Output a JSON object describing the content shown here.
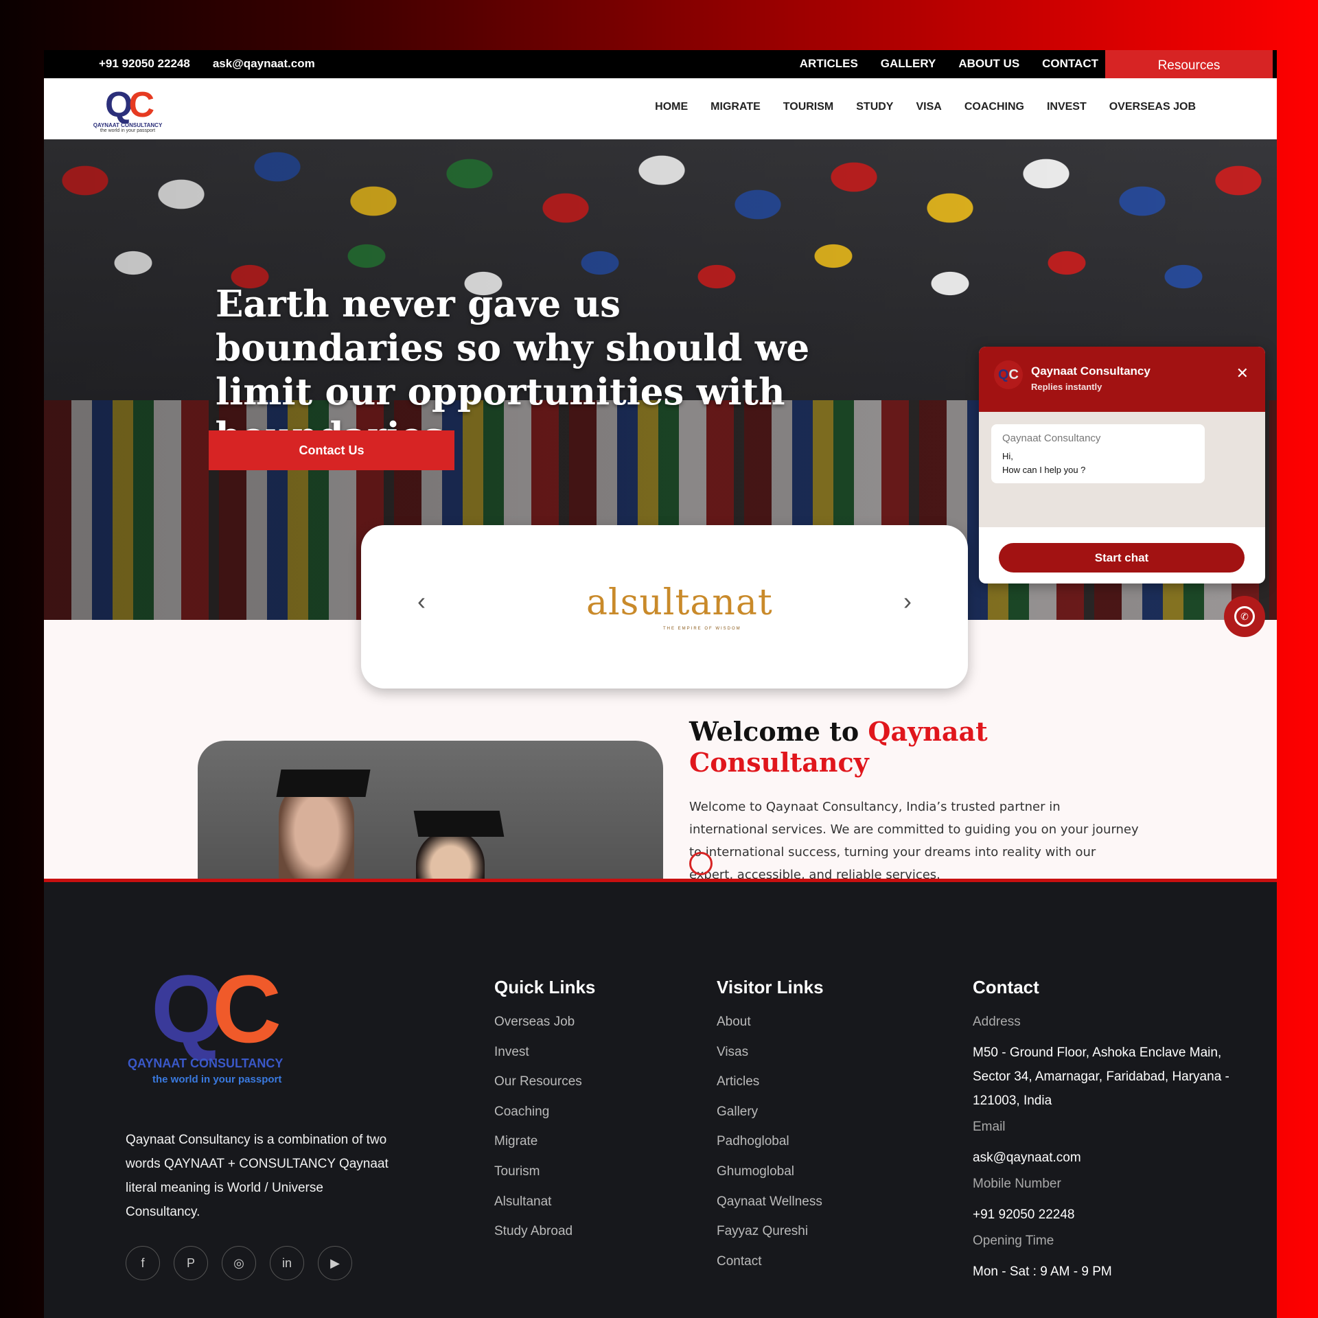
{
  "topbar": {
    "phone": "+91 92050 22248",
    "email": "ask@qaynaat.com",
    "links": [
      "ARTICLES",
      "GALLERY",
      "ABOUT US",
      "CONTACT"
    ],
    "resources_label": "Resources"
  },
  "header": {
    "logo_brand_prefix": "QAYNAAT ",
    "logo_brand_suffix": "CONSULTANCY",
    "logo_tagline": "the world in your passport",
    "nav": [
      "HOME",
      "MIGRATE",
      "TOURISM",
      "STUDY",
      "VISA",
      "COACHING",
      "INVEST",
      "OVERSEAS JOB"
    ]
  },
  "hero": {
    "headline": "Earth never gave us boundaries so why should we limit our opportunities with boundaries",
    "cta_label": "Contact Us"
  },
  "carousel": {
    "prev_icon": "chevron-left-icon",
    "next_icon": "chevron-right-icon",
    "brand_name": "alsultanat",
    "brand_tagline": "THE EMPIRE OF WISDOM"
  },
  "welcome": {
    "title_prefix": "Welcome to ",
    "title_highlight": "Qaynaat Consultancy",
    "body": "Welcome to Qaynaat Consultancy, India’s trusted partner in international services. We are committed to guiding you on your journey to international success, turning your dreams into reality with our expert, accessible, and reliable services."
  },
  "chat": {
    "name": "Qaynaat Consultancy",
    "status": "Replies instantly",
    "sender": "Qaynaat Consultancy",
    "message_line1": "Hi,",
    "message_line2": "How can I help you ?",
    "start_label": "Start chat"
  },
  "footer": {
    "logo_brand_prefix": "QAYNAAT ",
    "logo_brand_suffix": "CONSULTANCY",
    "logo_tagline": "the world in your passport",
    "about": "Qaynaat Consultancy is a combination of two words QAYNAAT + CONSULTANCY Qaynaat literal meaning is World / Universe Consultancy.",
    "socials": [
      "facebook-icon",
      "pinterest-icon",
      "instagram-icon",
      "linkedin-icon",
      "youtube-icon"
    ],
    "quick_links": {
      "title": "Quick Links",
      "items": [
        "Overseas Job",
        "Invest",
        "Our Resources",
        "Coaching",
        "Migrate",
        "Tourism",
        "Alsultanat",
        "Study Abroad"
      ]
    },
    "visitor_links": {
      "title": "Visitor Links",
      "items": [
        "About",
        "Visas",
        "Articles",
        "Gallery",
        "Padhoglobal",
        "Ghumoglobal",
        "Qaynaat Wellness",
        "Fayyaz Qureshi",
        "Contact"
      ]
    },
    "contact": {
      "title": "Contact",
      "address_label": "Address",
      "address": "M50 - Ground Floor, Ashoka Enclave Main, Sector 34, Amarnagar, Faridabad, Haryana - 121003, India",
      "email_label": "Email",
      "email": "ask@qaynaat.com",
      "mobile_label": "Mobile Number",
      "mobile": "+91 92050 22248",
      "hours_label": "Opening Time",
      "hours": "Mon - Sat : 9 AM - 9 PM"
    }
  },
  "colors": {
    "accent": "#d72424",
    "chat_header": "#a21212",
    "footer_bg": "#17181c"
  }
}
